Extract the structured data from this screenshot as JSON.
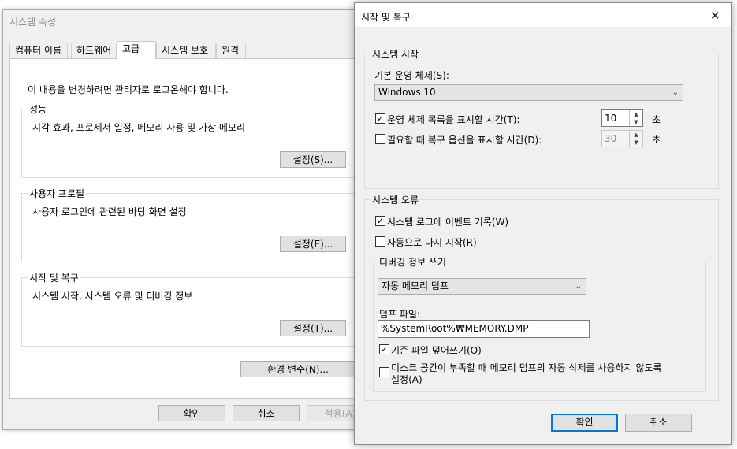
{
  "sysprops": {
    "title": "시스템 속성",
    "tabs": [
      "컴퓨터 이름",
      "하드웨어",
      "고급",
      "시스템 보호",
      "원격"
    ],
    "admin_notice": "이 내용을 변경하려면 관리자로 로그온해야 합니다.",
    "performance": {
      "label": "성능",
      "desc": "시각 효과, 프로세서 일정, 메모리 사용 및 가상 메모리",
      "button": "설정(S)..."
    },
    "user_profiles": {
      "label": "사용자 프로필",
      "desc": "사용자 로그인에 관련된 바탕 화면 설정",
      "button": "설정(E)..."
    },
    "startup_recovery": {
      "label": "시작 및 복구",
      "desc": "시스템 시작, 시스템 오류 및 디버깅 정보",
      "button": "설정(T)..."
    },
    "env_button": "환경 변수(N)...",
    "ok": "확인",
    "cancel": "취소",
    "apply": "적용(A)"
  },
  "dialog": {
    "title": "시작 및 복구",
    "close_glyph": "✕",
    "system_startup": {
      "label": "시스템 시작",
      "default_os_label": "기본 운영 체제(S):",
      "default_os_value": "Windows 10",
      "os_list_label": "운영 체제 목록을 표시할 시간(T):",
      "os_list_checked": true,
      "os_list_value": "10",
      "recovery_label": "필요할 때 복구 옵션을 표시할 시간(D):",
      "recovery_checked": false,
      "recovery_value": "30",
      "seconds_unit": "초"
    },
    "system_failure": {
      "label": "시스템 오류",
      "write_event": "시스템 로그에 이벤트 기록(W)",
      "write_event_checked": true,
      "auto_restart": "자동으로 다시 시작(R)",
      "auto_restart_checked": false,
      "debug": {
        "label": "디버깅 정보 쓰기",
        "dump_type": "자동 메모리 덤프",
        "dump_file_label": "덤프 파일:",
        "dump_file_value": "%SystemRoot%₩MEMORY.DMP",
        "overwrite": "기존 파일 덮어쓰기(O)",
        "overwrite_checked": true,
        "disable_auto_delete_line1": "디스크 공간이 부족할 때 메모리 덤프의 자동 삭제를 사용하지 않도록",
        "disable_auto_delete_line2": "설정(A)",
        "disable_auto_delete_checked": false
      }
    },
    "ok": "확인",
    "cancel": "취소"
  },
  "colors": {
    "accent": "#0078d7",
    "dialog_bg": "#f0f0f0",
    "button_bg": "#e1e1e1"
  }
}
